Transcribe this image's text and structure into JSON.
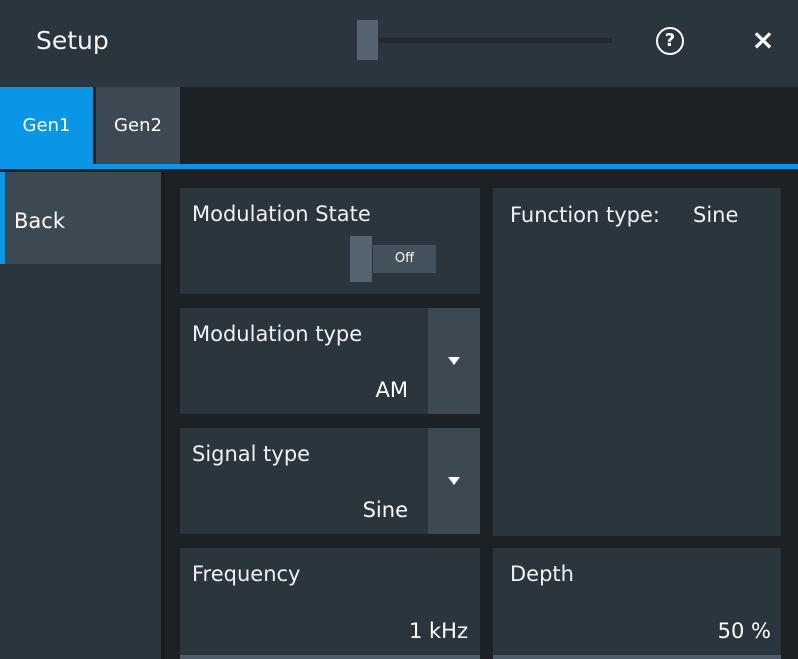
{
  "window": {
    "title": "Setup",
    "help_glyph": "?",
    "close_glyph": "×"
  },
  "tabs": [
    {
      "label": "Gen1",
      "active": true
    },
    {
      "label": "Gen2",
      "active": false
    }
  ],
  "sidebar": {
    "back_label": "Back"
  },
  "modulation_state": {
    "label": "Modulation State",
    "toggle_text": "Off"
  },
  "function_type": {
    "label": "Function type:",
    "value": "Sine"
  },
  "modulation_type": {
    "label": "Modulation type",
    "value": "AM"
  },
  "signal_type": {
    "label": "Signal type",
    "value": "Sine"
  },
  "frequency": {
    "label": "Frequency",
    "value": "1 kHz"
  },
  "depth": {
    "label": "Depth",
    "value": "50 %"
  },
  "colors": {
    "accent": "#0a96e6",
    "background": "#1c2125",
    "panel": "#2b353d",
    "button": "#3c4852"
  },
  "icons": {
    "help": "help-icon",
    "close": "close-icon",
    "dropdown": "chevron-down-icon"
  }
}
